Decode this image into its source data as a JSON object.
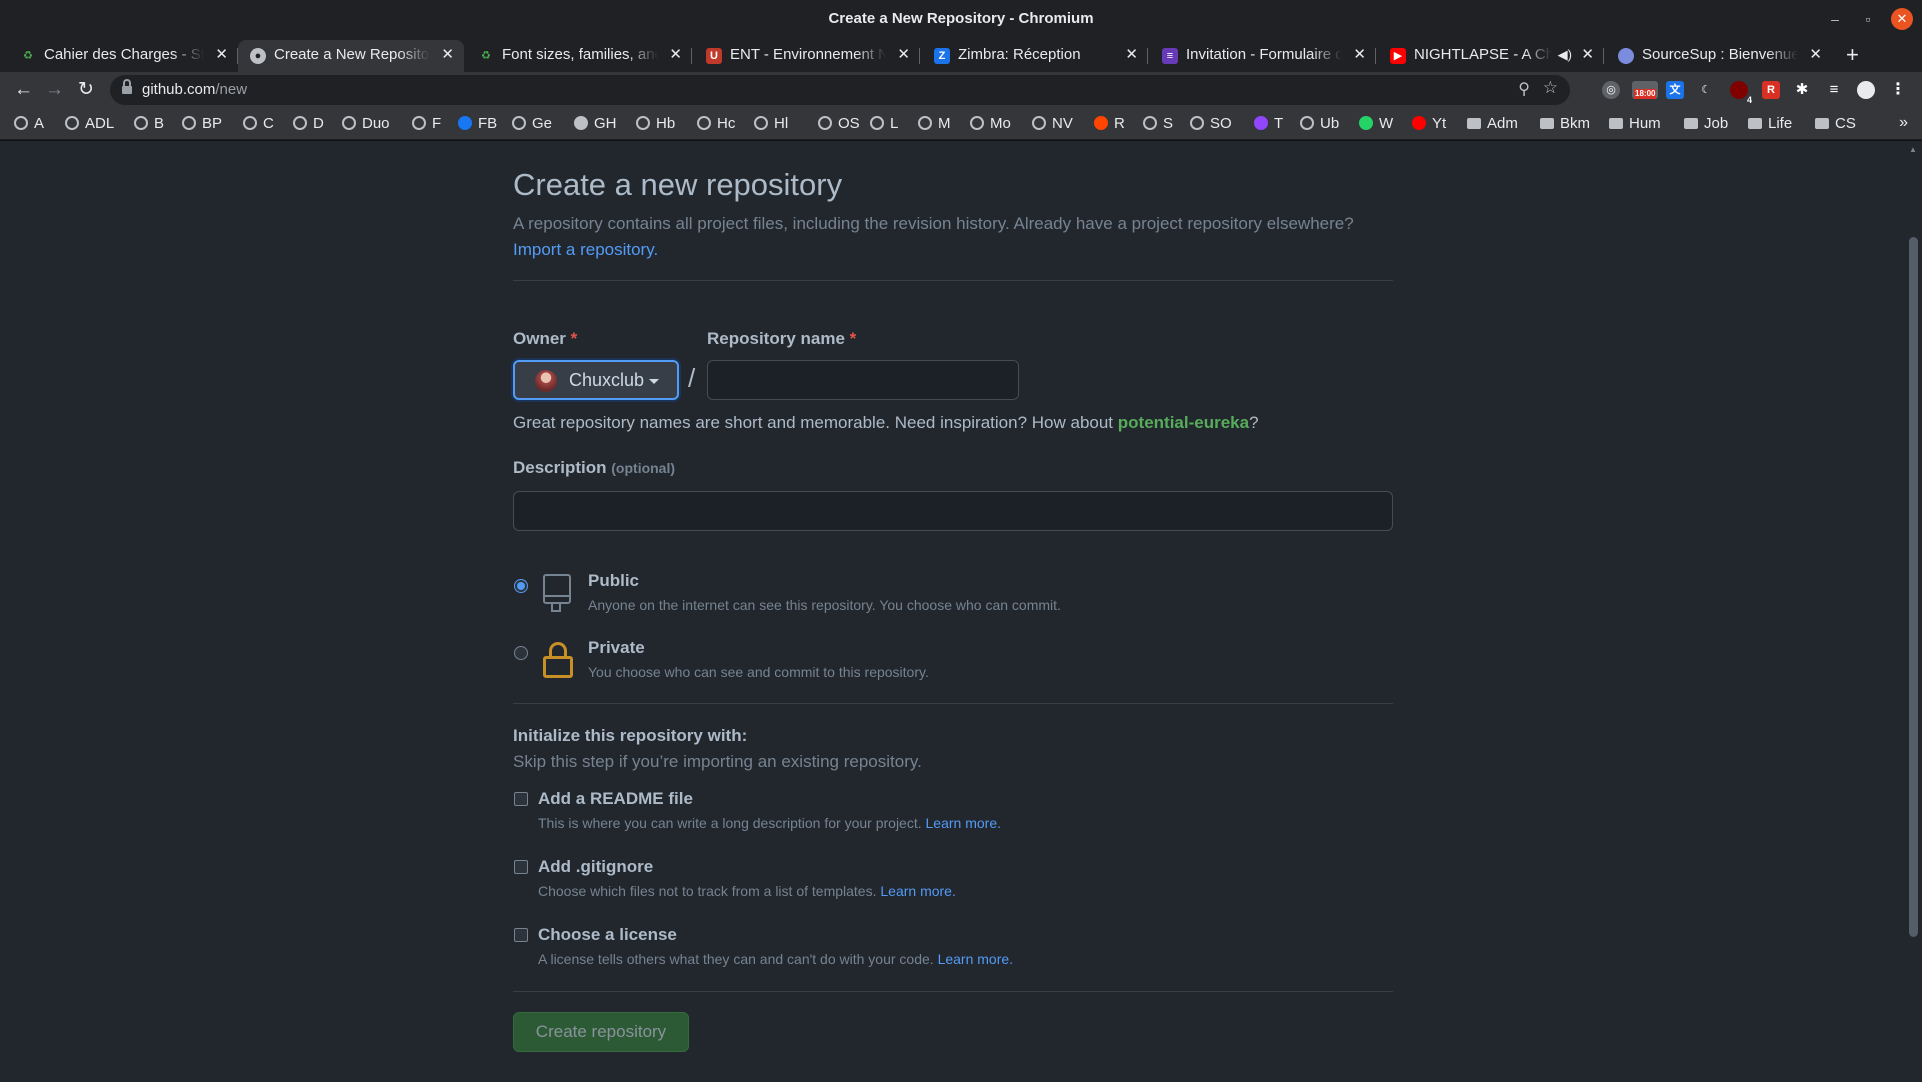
{
  "window": {
    "title": "Create a New Repository - Chromium"
  },
  "tabs": [
    {
      "label": "Cahier des Charges - Sta",
      "icon": "wiki-icon",
      "color": "#4caf50"
    },
    {
      "label": "Create a New Repository",
      "icon": "github-icon",
      "color": "#bdc1c6",
      "active": true
    },
    {
      "label": "Font sizes, families, and",
      "icon": "wiki-icon",
      "color": "#4caf50"
    },
    {
      "label": "ENT - Environnement Nu",
      "icon": "ent-icon",
      "color": "#c0392b"
    },
    {
      "label": "Zimbra: Réception",
      "icon": "zimbra-icon",
      "color": "#1a73e8"
    },
    {
      "label": "Invitation - Formulaire d",
      "icon": "forms-icon",
      "color": "#673ab7"
    },
    {
      "label": "NIGHTLAPSE - A Chill",
      "icon": "youtube-icon",
      "color": "#ff0000"
    },
    {
      "label": "SourceSup : Bienvenue",
      "icon": "sourcesup-icon",
      "color": "#7b8cde"
    }
  ],
  "address_bar": {
    "domain": "github.com",
    "path": "/new"
  },
  "extensions": {
    "badge_text": "18:00",
    "badge_count": "4",
    "reddit_letter": "R"
  },
  "bookmarks": [
    {
      "label": "A",
      "icon": "globe"
    },
    {
      "label": "ADL",
      "icon": "globe"
    },
    {
      "label": "B",
      "icon": "globe"
    },
    {
      "label": "BP",
      "icon": "globe"
    },
    {
      "label": "C",
      "icon": "globe"
    },
    {
      "label": "D",
      "icon": "globe"
    },
    {
      "label": "Duo",
      "icon": "globe"
    },
    {
      "label": "F",
      "icon": "globe"
    },
    {
      "label": "FB",
      "icon": "facebook"
    },
    {
      "label": "Ge",
      "icon": "globe"
    },
    {
      "label": "GH",
      "icon": "github"
    },
    {
      "label": "Hb",
      "icon": "globe"
    },
    {
      "label": "Hc",
      "icon": "globe"
    },
    {
      "label": "Hl",
      "icon": "globe"
    },
    {
      "label": "OS",
      "icon": "globe"
    },
    {
      "label": "L",
      "icon": "globe"
    },
    {
      "label": "M",
      "icon": "globe"
    },
    {
      "label": "Mo",
      "icon": "globe"
    },
    {
      "label": "NV",
      "icon": "globe"
    },
    {
      "label": "R",
      "icon": "reddit"
    },
    {
      "label": "S",
      "icon": "globe"
    },
    {
      "label": "SO",
      "icon": "globe"
    },
    {
      "label": "T",
      "icon": "twitch"
    },
    {
      "label": "Ub",
      "icon": "globe"
    },
    {
      "label": "W",
      "icon": "whatsapp"
    },
    {
      "label": "Yt",
      "icon": "youtube"
    },
    {
      "label": "Adm",
      "icon": "folder"
    },
    {
      "label": "Bkm",
      "icon": "folder"
    },
    {
      "label": "Hum",
      "icon": "folder"
    },
    {
      "label": "Job",
      "icon": "folder"
    },
    {
      "label": "Life",
      "icon": "folder"
    },
    {
      "label": "CS",
      "icon": "folder"
    }
  ],
  "form": {
    "heading": "Create a new repository",
    "subhead_text": "A repository contains all project files, including the revision history. Already have a project repository elsewhere?",
    "import_link": "Import a repository.",
    "owner_label": "Owner",
    "owner_value": "Chuxclub",
    "required_mark": "*",
    "slash": "/",
    "repo_name_label": "Repository name",
    "repo_name_value": "",
    "hint_prefix": "Great repository names are short and memorable. Need inspiration? How about ",
    "hint_suggestion": "potential-eureka",
    "hint_suffix": "?",
    "description_label": "Description",
    "description_optional": "(optional)",
    "description_value": "",
    "visibility": [
      {
        "title": "Public",
        "desc": "Anyone on the internet can see this repository. You choose who can commit.",
        "checked": true
      },
      {
        "title": "Private",
        "desc": "You choose who can see and commit to this repository.",
        "checked": false
      }
    ],
    "init_heading": "Initialize this repository with:",
    "init_sub": "Skip this step if you’re importing an existing repository.",
    "init_options": [
      {
        "title": "Add a README file",
        "desc": "This is where you can write a long description for your project.",
        "link": "Learn more.",
        "checked": false
      },
      {
        "title": "Add .gitignore",
        "desc": "Choose which files not to track from a list of templates.",
        "link": "Learn more.",
        "checked": false
      },
      {
        "title": "Choose a license",
        "desc": "A license tells others what they can and can't do with your code.",
        "link": "Learn more.",
        "checked": false
      }
    ],
    "create_button": "Create repository"
  },
  "colors": {
    "accent_blue": "#539bf5",
    "success_green": "#57ab5a",
    "lock_yellow": "#c69026",
    "page_bg": "#22272e"
  }
}
